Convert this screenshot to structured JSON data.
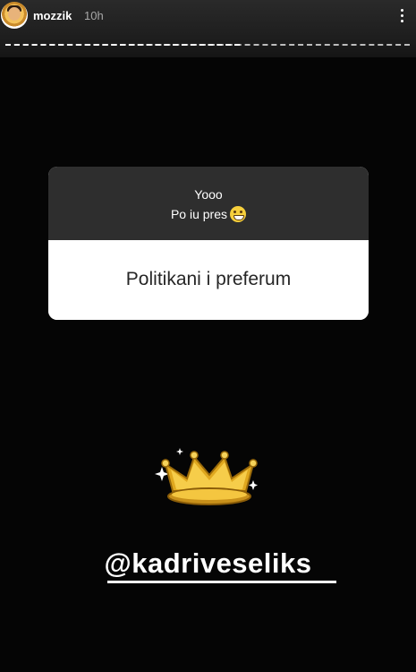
{
  "header": {
    "username": "mozzik",
    "time": "10h",
    "progress_fraction": 0.58
  },
  "question_card": {
    "prompt_line1": "Yooo",
    "prompt_line2": "Po iu pres",
    "answer": "Politikani i preferum"
  },
  "mention": "@kadriveseliks",
  "icons": {
    "avatar": "user-avatar",
    "more": "more-options-icon",
    "emoji": "grinning-face-icon",
    "crown": "crown-sticker-icon"
  },
  "colors": {
    "background": "#050505",
    "card_top": "#2e2e2e",
    "card_bottom": "#ffffff",
    "crown_gold": "#e0a81e"
  }
}
